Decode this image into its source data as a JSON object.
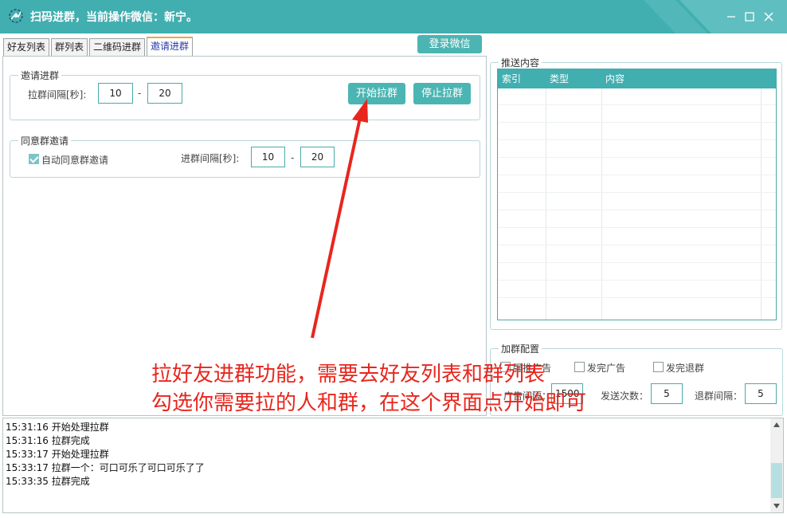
{
  "window": {
    "title": "扫码进群，当前操作微信：新宁。",
    "controls": [
      "minimize",
      "maximize",
      "close"
    ]
  },
  "tabs": [
    {
      "label": "好友列表",
      "active": false
    },
    {
      "label": "群列表",
      "active": false
    },
    {
      "label": "二维码进群",
      "active": false
    },
    {
      "label": "邀请进群",
      "active": true
    }
  ],
  "login_button": "登录微信",
  "invite_group": {
    "title": "邀请进群",
    "interval_label": "拉群间隔[秒]:",
    "interval_min": "10",
    "interval_sep": "-",
    "interval_max": "20",
    "start_button": "开始拉群",
    "stop_button": "停止拉群"
  },
  "accept_group": {
    "title": "同意群邀请",
    "auto_accept_label": "自动同意群邀请",
    "auto_accept_checked": true,
    "interval_label": "进群间隔[秒]:",
    "interval_min": "10",
    "interval_sep": "-",
    "interval_max": "20"
  },
  "push_content": {
    "title": "推送内容",
    "columns": [
      "索引",
      "类型",
      "内容"
    ]
  },
  "add_group_config": {
    "title": "加群配置",
    "option1_label": "强推广告",
    "option2_label": "发完广告",
    "leave_after_label": "发完退群",
    "ad_interval_label": "广告间隔：",
    "ad_interval_value": "1500",
    "send_count_label": "发送次数：",
    "send_count_value": "5",
    "leave_interval_label": "退群间隔：",
    "leave_interval_value": "5"
  },
  "log": {
    "lines": [
      "15:31:16 开始处理拉群",
      "15:31:16 拉群完成",
      "15:33:17 开始处理拉群",
      "15:33:17 拉群一个：可口可乐了可口可乐了了",
      "15:33:35 拉群完成"
    ]
  },
  "annotation": {
    "line1": "拉好友进群功能，需要去好友列表和群列表",
    "line2": "勾选你需要拉的人和群，在这个界面点开始即可",
    "color": "#e8261d"
  },
  "colors": {
    "accent": "#41aeb0",
    "button": "#4bb5b3",
    "active_tab_border": "#f2a541"
  }
}
